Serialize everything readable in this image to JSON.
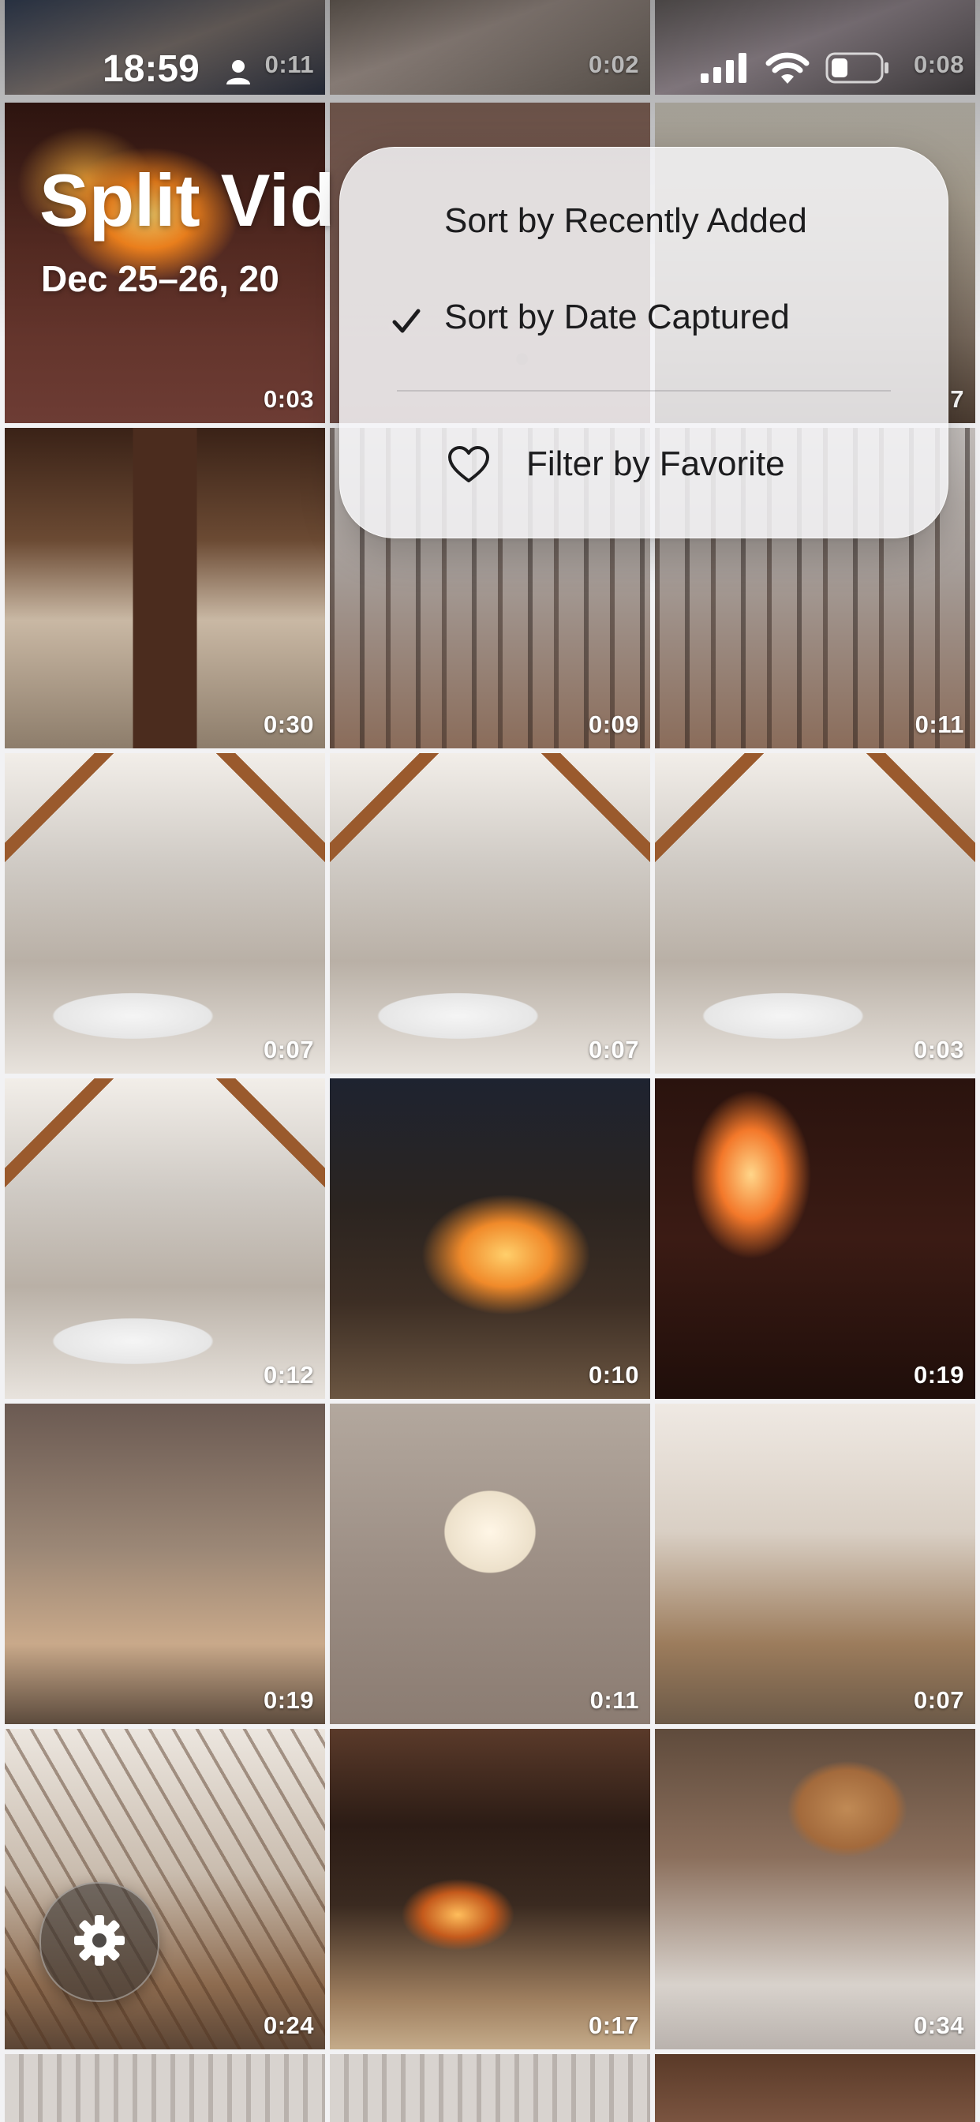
{
  "status_bar": {
    "time": "18:59"
  },
  "album": {
    "title": "Split Vid",
    "subtitle": "Dec 25–26, 20"
  },
  "menu": {
    "items": [
      {
        "label": "Sort by Recently Added",
        "checked": false
      },
      {
        "label": "Sort by Date Captured",
        "checked": true
      },
      {
        "label": "Filter by Favorite",
        "icon": "heart-icon"
      }
    ]
  },
  "videos": [
    {
      "duration": "0:11",
      "scene": "people"
    },
    {
      "duration": "0:02",
      "scene": "people2"
    },
    {
      "duration": "0:08",
      "scene": "people3"
    },
    {
      "duration": "0:03",
      "scene": "fire"
    },
    {
      "duration": "",
      "scene": "stones"
    },
    {
      "duration": "7",
      "scene": "cabin"
    },
    {
      "duration": "0:30",
      "scene": "interior"
    },
    {
      "duration": "0:09",
      "scene": "forest"
    },
    {
      "duration": "0:11",
      "scene": "forest"
    },
    {
      "duration": "0:07",
      "scene": "bath"
    },
    {
      "duration": "0:07",
      "scene": "bath"
    },
    {
      "duration": "0:03",
      "scene": "bath"
    },
    {
      "duration": "0:12",
      "scene": "bath"
    },
    {
      "duration": "0:10",
      "scene": "fireplace"
    },
    {
      "duration": "0:19",
      "scene": "fire2"
    },
    {
      "duration": "0:19",
      "scene": "kids"
    },
    {
      "duration": "0:11",
      "scene": "marsh"
    },
    {
      "duration": "0:07",
      "scene": "living"
    },
    {
      "duration": "0:24",
      "scene": "stairs"
    },
    {
      "duration": "0:17",
      "scene": "hearth"
    },
    {
      "duration": "0:34",
      "scene": "marsh2"
    },
    {
      "duration": "",
      "scene": "blinds"
    },
    {
      "duration": "",
      "scene": "blinds"
    },
    {
      "duration": "",
      "scene": "woodceil"
    }
  ],
  "colors": {
    "menu_bg": "#f5f5f7",
    "text": "#1c1c1e",
    "grid_bg": "#f2f2f4"
  },
  "floating_button": {
    "icon": "gear-icon"
  }
}
